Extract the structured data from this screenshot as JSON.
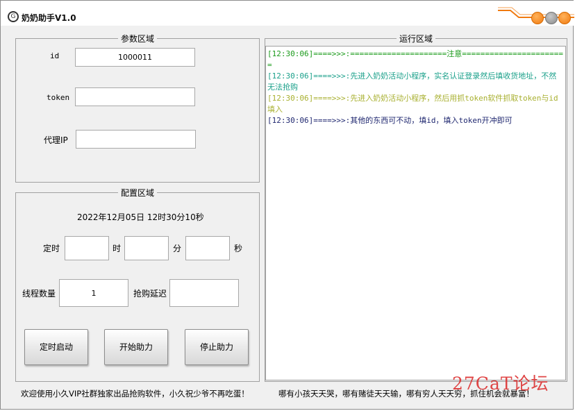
{
  "window": {
    "title": "奶奶助手V1.0",
    "icon_glyph": "G"
  },
  "params": {
    "title": "参数区域",
    "id_label": "id",
    "id_value": "1000011",
    "token_label": "token",
    "token_value": "",
    "proxy_label": "代理IP",
    "proxy_value": ""
  },
  "config": {
    "title": "配置区域",
    "datetime": "2022年12月05日  12时30分10秒",
    "timer_label": "定时",
    "hour_unit": "时",
    "minute_unit": "分",
    "second_unit": "秒",
    "hour_value": "",
    "minute_value": "",
    "second_value": "",
    "threads_label": "线程数量",
    "threads_value": "1",
    "delay_label": "抢购延迟",
    "delay_value": "",
    "btn_timer": "定时启动",
    "btn_start": "开始助力",
    "btn_stop": "停止助力"
  },
  "run": {
    "title": "运行区域",
    "logs": [
      {
        "text": "[12:30:06]====>>>:=====================注意=======================",
        "color": "#1a9a1a"
      },
      {
        "text": "[12:30:06]====>>>:先进入奶奶活动小程序，实名认证登录然后填收货地址，不然无法抢购",
        "color": "#1aa08a"
      },
      {
        "text": "[12:30:06]====>>>:先进入奶奶活动小程序，然后用抓token软件抓取token与id填入",
        "color": "#a8b030"
      },
      {
        "text": "[12:30:06]====>>>:其他的东西可不动，填id，填入token开冲即可",
        "color": "#202870"
      }
    ]
  },
  "footer": {
    "left": "欢迎使用小久VIP社群独家出品抢购软件，小久祝少爷不再吃蛋！",
    "right": "哪有小孩天天哭，哪有赌徒天天输，哪有穷人天天穷，抓住机会就暴富！"
  },
  "watermark": "27CaT论坛",
  "colors": {
    "accent": "#f07a10",
    "panel_border": "#a0a0a0"
  }
}
